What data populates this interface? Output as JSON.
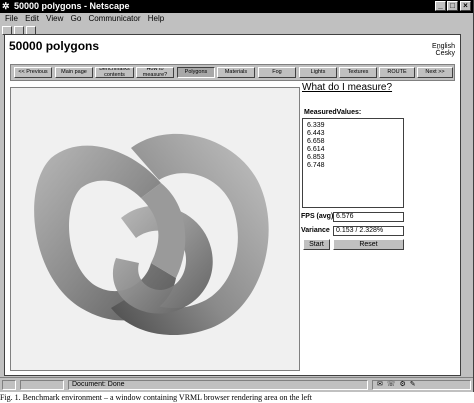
{
  "window": {
    "title": "50000 polygons - Netscape"
  },
  "menu": [
    "File",
    "Edit",
    "View",
    "Go",
    "Communicator",
    "Help"
  ],
  "page": {
    "title": "50000 polygons",
    "languages": [
      "English",
      "Česky"
    ]
  },
  "nav": [
    {
      "label": "<< Previous",
      "active": false
    },
    {
      "label": "Main page",
      "active": false
    },
    {
      "label": "Benchmarks contents",
      "active": false
    },
    {
      "label": "How to measure?",
      "active": false
    },
    {
      "label": "Polygons",
      "active": true
    },
    {
      "label": "Materials",
      "active": false
    },
    {
      "label": "Fog",
      "active": false
    },
    {
      "label": "Lights",
      "active": false
    },
    {
      "label": "Textures",
      "active": false
    },
    {
      "label": "ROUTE",
      "active": false
    },
    {
      "label": "Next >>",
      "active": false
    }
  ],
  "panel": {
    "question": "What do I measure?",
    "measured_label": "MeasuredValues:",
    "measured_values": [
      "6.339",
      "6.443",
      "6.658",
      "6.614",
      "6.853",
      "6.748"
    ],
    "fps_label": "FPS (avg)",
    "fps_value": "6.576",
    "variance_label": "Variance",
    "variance_value": "0.153 / 2.328%",
    "start_label": "Start",
    "reset_label": "Reset"
  },
  "status": {
    "text": "Document: Done"
  },
  "caption": "Fig. 1. Benchmark environment – a window containing VRML browser rendering area on the left"
}
